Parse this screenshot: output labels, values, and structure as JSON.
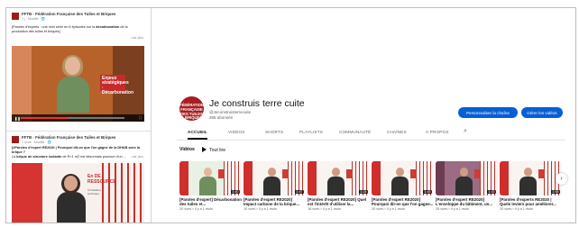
{
  "post1": {
    "org": "FFTB - Fédération Française des Tuiles et Briques",
    "meta": "2 j · Modifié · 🌐",
    "text_pre": "[Paroles d'experts : une mini série en 6 épisodes sur la ",
    "text_bold": "décarbonation",
    "text_post": " de la production des tuiles et briques]",
    "more": "...voir plus",
    "card_text": "Enjeux stratégiques · Décarbonation"
  },
  "post2": {
    "org": "FFTB - Fédération Française des Tuiles et Briques",
    "meta": "1 mois · Modifié · 🌐",
    "text_bold": "[#Paroles d'expert RE2020 | Pourquoi dit-on que l'on gagne de la DHAB avec la brique ?",
    "text_mid": "La ",
    "text_bold2": "brique de structure isolante",
    "text_post": " de R>1 m2 est désormais pourvue d'un ...",
    "more": "voir plus",
    "card_title": "En DE RESSOURCE",
    "card_sub": "Conseillère technique"
  },
  "channel": {
    "name": "Je construis terre cuite",
    "handle": "@Jeconstruisterrecuite",
    "subs": "355 abonnés",
    "avatar_text": "FÉDÉRATION FRANÇAISE DES TUILES & BRIQUES",
    "customize_label": "Personnaliser la chaîne",
    "manage_label": "Gérer les vidéos"
  },
  "tabs": [
    "ACCUEIL",
    "VIDÉOS",
    "SHORTS",
    "PLAYLISTS",
    "COMMUNAUTÉ",
    "CHAÎNES",
    "À PROPOS"
  ],
  "section": {
    "label": "Vidéos",
    "play_all": "Tout lire"
  },
  "videos": [
    {
      "title": "[Paroles d'expert] Décarbonation des tuiles et...",
      "meta": "20 vues • Il y a 1 mois",
      "duration": "1:40"
    },
    {
      "title": "[Paroles d'expert RE2020] Impact carbone de la brique...",
      "meta": "10 vues • Il y a 1 mois",
      "duration": "1:47"
    },
    {
      "title": "[Paroles d'expert RE2020] Quel est l'intérêt d'utiliser la...",
      "meta": "18 vues • Il y a 1 mois",
      "duration": "1:24"
    },
    {
      "title": "[Paroles d'expert RE2020] Pourquoi dit-on que l'on gagne...",
      "meta": "20 vues • Il y a 1 mois",
      "duration": "1:48"
    },
    {
      "title": "[Paroles d'expert RE2020] L'enveloppe du bâtiment, un...",
      "meta": "25 vues • Il y a 1 mois",
      "duration": "1:15"
    },
    {
      "title": "[Paroles d'experts RE2020 | Quels leviers pour améliorer...",
      "meta": "20 vues • Il y a 1 mois",
      "duration": "1:58"
    }
  ],
  "video1_progress": 0.45,
  "colors": {
    "accent_blue": "#065fd4",
    "brand_red": "#a81d22"
  }
}
